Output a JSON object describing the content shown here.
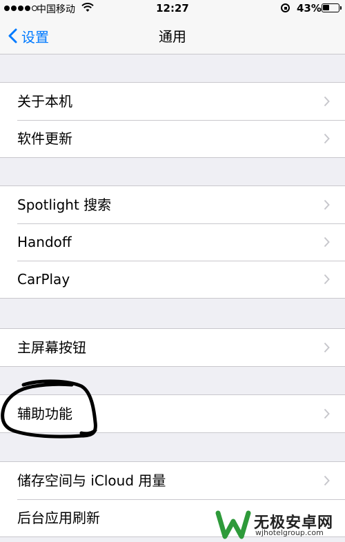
{
  "status_bar": {
    "carrier": "中国移动",
    "time": "12:27",
    "battery_percent": "43%",
    "battery_level": 0.43,
    "signal_bars_filled": 4,
    "signal_bars_total": 5
  },
  "nav": {
    "back_label": "设置",
    "title": "通用"
  },
  "groups": [
    {
      "rows": [
        {
          "label": "关于本机"
        },
        {
          "label": "软件更新"
        }
      ]
    },
    {
      "rows": [
        {
          "label": "Spotlight 搜索"
        },
        {
          "label": "Handoff"
        },
        {
          "label": "CarPlay"
        }
      ]
    },
    {
      "rows": [
        {
          "label": "主屏幕按钮"
        }
      ]
    },
    {
      "rows": [
        {
          "label": "辅助功能"
        }
      ]
    },
    {
      "rows": [
        {
          "label": "储存空间与 iCloud 用量"
        },
        {
          "label": "后台应用刷新"
        }
      ]
    }
  ],
  "annotation": {
    "type": "hand-drawn-circle",
    "color": "#000000",
    "target": "辅助功能"
  },
  "watermark": {
    "brand": "无极安卓网",
    "url": "wjhotelgroup.com",
    "icon": "green-w-logo"
  },
  "colors": {
    "accent": "#007aff",
    "background": "#efeff4",
    "chevron": "#c7c7cc",
    "separator": "#c8c7cc"
  }
}
